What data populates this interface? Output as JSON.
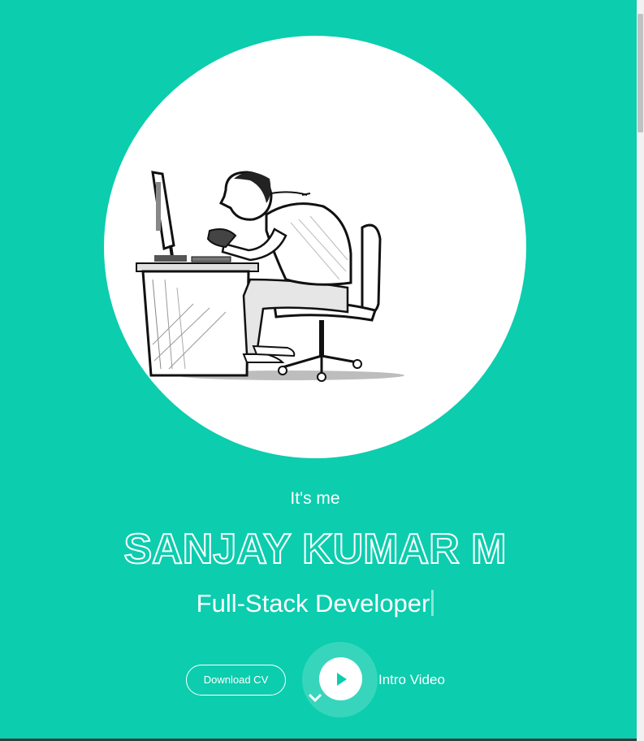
{
  "hero": {
    "background_color": "#0ccdae",
    "intro": "It's me",
    "name": "SANJAY KUMAR M",
    "role": "Full-Stack Developer",
    "avatar_illustration": "developer-at-desk-sketch"
  },
  "actions": {
    "download_cv": "Download CV",
    "intro_video": "Intro Video"
  },
  "icons": {
    "play": "play-icon",
    "scroll_down": "chevron-down-icon"
  }
}
